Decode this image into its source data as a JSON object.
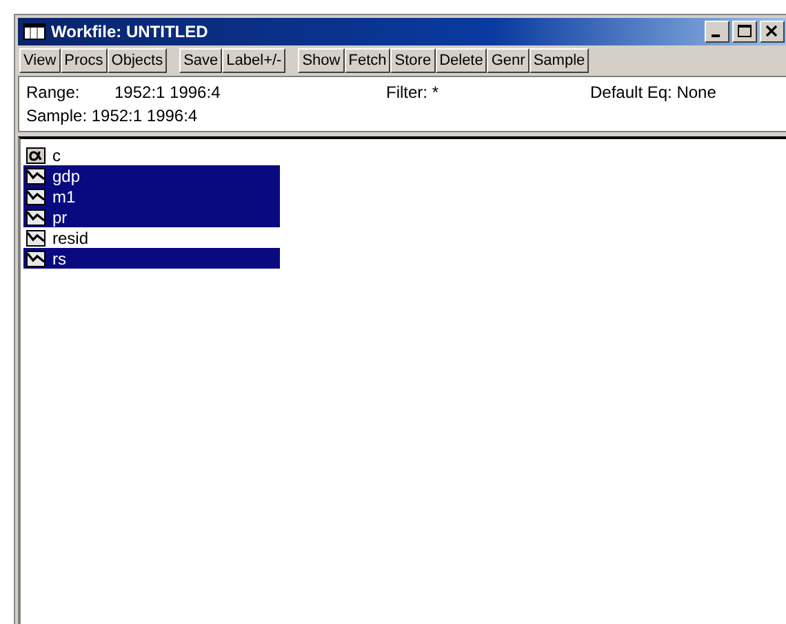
{
  "window": {
    "title": "Workfile: UNTITLED"
  },
  "toolbar": [
    [
      "View",
      "Procs",
      "Objects"
    ],
    [
      "Save",
      "Label+/-"
    ],
    [
      "Show",
      "Fetch",
      "Store",
      "Delete",
      "Genr",
      "Sample"
    ]
  ],
  "info": {
    "range_label": "Range:",
    "range": "1952:1 1996:4",
    "filter": "Filter: *",
    "default_eq": "Default Eq: None",
    "sample": "Sample: 1952:1 1996:4"
  },
  "objects": [
    {
      "name": "c",
      "kind": "coef",
      "selected": false
    },
    {
      "name": "gdp",
      "kind": "series",
      "selected": true
    },
    {
      "name": "m1",
      "kind": "series",
      "selected": true
    },
    {
      "name": "pr",
      "kind": "series",
      "selected": true
    },
    {
      "name": "resid",
      "kind": "series",
      "selected": false
    },
    {
      "name": "rs",
      "kind": "series",
      "selected": true
    }
  ]
}
